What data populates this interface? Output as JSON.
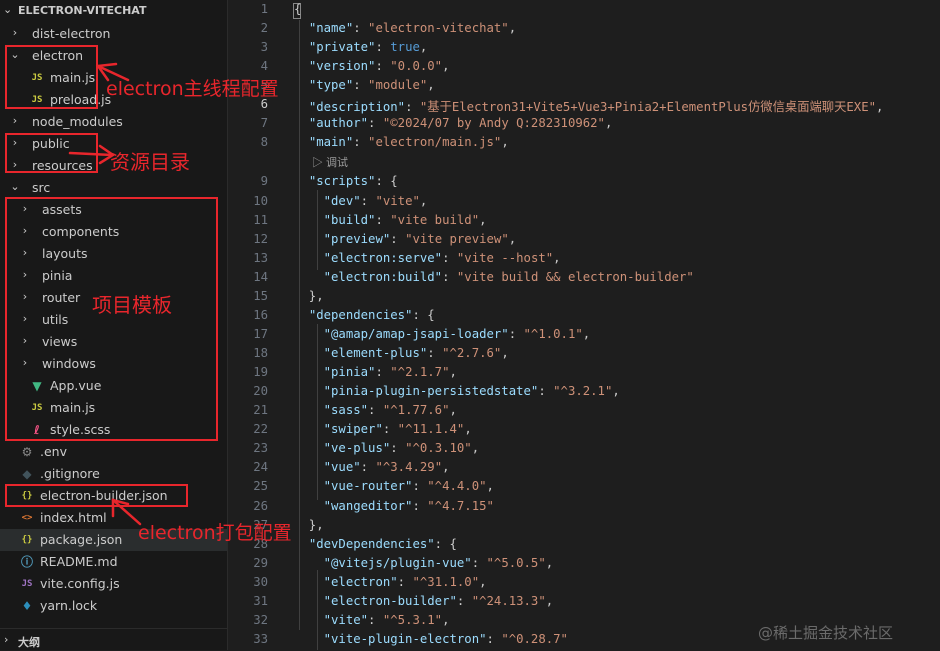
{
  "explorer": {
    "project": "ELECTRON-VITECHAT",
    "items": [
      {
        "name": "dist-electron",
        "type": "folder",
        "open": false,
        "depth": 0
      },
      {
        "name": "electron",
        "type": "folder",
        "open": true,
        "depth": 0
      },
      {
        "name": "main.js",
        "type": "js",
        "depth": 1
      },
      {
        "name": "preload.js",
        "type": "js",
        "depth": 1
      },
      {
        "name": "node_modules",
        "type": "folder",
        "open": false,
        "depth": 0
      },
      {
        "name": "public",
        "type": "folder",
        "open": false,
        "depth": 0
      },
      {
        "name": "resources",
        "type": "folder",
        "open": false,
        "depth": 0
      },
      {
        "name": "src",
        "type": "folder",
        "open": true,
        "depth": 0
      },
      {
        "name": "assets",
        "type": "folder",
        "open": false,
        "depth": 1
      },
      {
        "name": "components",
        "type": "folder",
        "open": false,
        "depth": 1
      },
      {
        "name": "layouts",
        "type": "folder",
        "open": false,
        "depth": 1
      },
      {
        "name": "pinia",
        "type": "folder",
        "open": false,
        "depth": 1
      },
      {
        "name": "router",
        "type": "folder",
        "open": false,
        "depth": 1
      },
      {
        "name": "utils",
        "type": "folder",
        "open": false,
        "depth": 1
      },
      {
        "name": "views",
        "type": "folder",
        "open": false,
        "depth": 1
      },
      {
        "name": "windows",
        "type": "folder",
        "open": false,
        "depth": 1
      },
      {
        "name": "App.vue",
        "type": "vue",
        "depth": 1
      },
      {
        "name": "main.js",
        "type": "js",
        "depth": 1
      },
      {
        "name": "style.scss",
        "type": "sass",
        "depth": 1
      },
      {
        "name": ".env",
        "type": "gear",
        "depth": 0
      },
      {
        "name": ".gitignore",
        "type": "git",
        "depth": 0
      },
      {
        "name": "electron-builder.json",
        "type": "json",
        "depth": 0
      },
      {
        "name": "index.html",
        "type": "html",
        "depth": 0
      },
      {
        "name": "package.json",
        "type": "json",
        "depth": 0,
        "selected": true
      },
      {
        "name": "README.md",
        "type": "info",
        "depth": 0
      },
      {
        "name": "vite.config.js",
        "type": "vite",
        "depth": 0
      },
      {
        "name": "yarn.lock",
        "type": "yarn",
        "depth": 0
      }
    ],
    "outline_label": "大纲"
  },
  "icons": {
    "folder_closed": "chevron-right-icon",
    "folder_open": "chevron-down-icon",
    "js": "JS",
    "json": "{}",
    "vue": "▼",
    "gear": "⚙",
    "git": "◆",
    "html": "<>",
    "info": "ⓘ",
    "vite": "JS",
    "yarn": "♦",
    "sass": "ℓ"
  },
  "editor": {
    "codelens": "▷ 调试",
    "lines": [
      [
        [
          "p",
          "{"
        ]
      ],
      [
        [
          "p",
          "  "
        ],
        [
          "k",
          "\"name\""
        ],
        [
          "p",
          ": "
        ],
        [
          "s",
          "\"electron-vitechat\""
        ],
        [
          "p",
          ","
        ]
      ],
      [
        [
          "p",
          "  "
        ],
        [
          "k",
          "\"private\""
        ],
        [
          "p",
          ": "
        ],
        [
          "b",
          "true"
        ],
        [
          "p",
          ","
        ]
      ],
      [
        [
          "p",
          "  "
        ],
        [
          "k",
          "\"version\""
        ],
        [
          "p",
          ": "
        ],
        [
          "s",
          "\"0.0.0\""
        ],
        [
          "p",
          ","
        ]
      ],
      [
        [
          "p",
          "  "
        ],
        [
          "k",
          "\"type\""
        ],
        [
          "p",
          ": "
        ],
        [
          "s",
          "\"module\""
        ],
        [
          "p",
          ","
        ]
      ],
      [
        [
          "p",
          "  "
        ],
        [
          "k",
          "\"description\""
        ],
        [
          "p",
          ": "
        ],
        [
          "s",
          "\"基于Electron31+Vite5+Vue3+Pinia2+ElementPlus仿微信桌面端聊天EXE\""
        ],
        [
          "p",
          ","
        ]
      ],
      [
        [
          "p",
          "  "
        ],
        [
          "k",
          "\"author\""
        ],
        [
          "p",
          ": "
        ],
        [
          "s",
          "\"©2024/07 by Andy Q:282310962\""
        ],
        [
          "p",
          ","
        ]
      ],
      [
        [
          "p",
          "  "
        ],
        [
          "k",
          "\"main\""
        ],
        [
          "p",
          ": "
        ],
        [
          "s",
          "\"electron/main.js\""
        ],
        [
          "p",
          ","
        ]
      ],
      [
        [
          "p",
          "  "
        ],
        [
          "k",
          "\"scripts\""
        ],
        [
          "p",
          ": {"
        ]
      ],
      [
        [
          "p",
          "    "
        ],
        [
          "k",
          "\"dev\""
        ],
        [
          "p",
          ": "
        ],
        [
          "s",
          "\"vite\""
        ],
        [
          "p",
          ","
        ]
      ],
      [
        [
          "p",
          "    "
        ],
        [
          "k",
          "\"build\""
        ],
        [
          "p",
          ": "
        ],
        [
          "s",
          "\"vite build\""
        ],
        [
          "p",
          ","
        ]
      ],
      [
        [
          "p",
          "    "
        ],
        [
          "k",
          "\"preview\""
        ],
        [
          "p",
          ": "
        ],
        [
          "s",
          "\"vite preview\""
        ],
        [
          "p",
          ","
        ]
      ],
      [
        [
          "p",
          "    "
        ],
        [
          "k",
          "\"electron:serve\""
        ],
        [
          "p",
          ": "
        ],
        [
          "s",
          "\"vite --host\""
        ],
        [
          "p",
          ","
        ]
      ],
      [
        [
          "p",
          "    "
        ],
        [
          "k",
          "\"electron:build\""
        ],
        [
          "p",
          ": "
        ],
        [
          "s",
          "\"vite build && electron-builder\""
        ]
      ],
      [
        [
          "p",
          "  },"
        ]
      ],
      [
        [
          "p",
          "  "
        ],
        [
          "k",
          "\"dependencies\""
        ],
        [
          "p",
          ": {"
        ]
      ],
      [
        [
          "p",
          "    "
        ],
        [
          "k",
          "\"@amap/amap-jsapi-loader\""
        ],
        [
          "p",
          ": "
        ],
        [
          "s",
          "\"^1.0.1\""
        ],
        [
          "p",
          ","
        ]
      ],
      [
        [
          "p",
          "    "
        ],
        [
          "k",
          "\"element-plus\""
        ],
        [
          "p",
          ": "
        ],
        [
          "s",
          "\"^2.7.6\""
        ],
        [
          "p",
          ","
        ]
      ],
      [
        [
          "p",
          "    "
        ],
        [
          "k",
          "\"pinia\""
        ],
        [
          "p",
          ": "
        ],
        [
          "s",
          "\"^2.1.7\""
        ],
        [
          "p",
          ","
        ]
      ],
      [
        [
          "p",
          "    "
        ],
        [
          "k",
          "\"pinia-plugin-persistedstate\""
        ],
        [
          "p",
          ": "
        ],
        [
          "s",
          "\"^3.2.1\""
        ],
        [
          "p",
          ","
        ]
      ],
      [
        [
          "p",
          "    "
        ],
        [
          "k",
          "\"sass\""
        ],
        [
          "p",
          ": "
        ],
        [
          "s",
          "\"^1.77.6\""
        ],
        [
          "p",
          ","
        ]
      ],
      [
        [
          "p",
          "    "
        ],
        [
          "k",
          "\"swiper\""
        ],
        [
          "p",
          ": "
        ],
        [
          "s",
          "\"^11.1.4\""
        ],
        [
          "p",
          ","
        ]
      ],
      [
        [
          "p",
          "    "
        ],
        [
          "k",
          "\"ve-plus\""
        ],
        [
          "p",
          ": "
        ],
        [
          "s",
          "\"^0.3.10\""
        ],
        [
          "p",
          ","
        ]
      ],
      [
        [
          "p",
          "    "
        ],
        [
          "k",
          "\"vue\""
        ],
        [
          "p",
          ": "
        ],
        [
          "s",
          "\"^3.4.29\""
        ],
        [
          "p",
          ","
        ]
      ],
      [
        [
          "p",
          "    "
        ],
        [
          "k",
          "\"vue-router\""
        ],
        [
          "p",
          ": "
        ],
        [
          "s",
          "\"^4.4.0\""
        ],
        [
          "p",
          ","
        ]
      ],
      [
        [
          "p",
          "    "
        ],
        [
          "k",
          "\"wangeditor\""
        ],
        [
          "p",
          ": "
        ],
        [
          "s",
          "\"^4.7.15\""
        ]
      ],
      [
        [
          "p",
          "  },"
        ]
      ],
      [
        [
          "p",
          "  "
        ],
        [
          "k",
          "\"devDependencies\""
        ],
        [
          "p",
          ": {"
        ]
      ],
      [
        [
          "p",
          "    "
        ],
        [
          "k",
          "\"@vitejs/plugin-vue\""
        ],
        [
          "p",
          ": "
        ],
        [
          "s",
          "\"^5.0.5\""
        ],
        [
          "p",
          ","
        ]
      ],
      [
        [
          "p",
          "    "
        ],
        [
          "k",
          "\"electron\""
        ],
        [
          "p",
          ": "
        ],
        [
          "s",
          "\"^31.1.0\""
        ],
        [
          "p",
          ","
        ]
      ],
      [
        [
          "p",
          "    "
        ],
        [
          "k",
          "\"electron-builder\""
        ],
        [
          "p",
          ": "
        ],
        [
          "s",
          "\"^24.13.3\""
        ],
        [
          "p",
          ","
        ]
      ],
      [
        [
          "p",
          "    "
        ],
        [
          "k",
          "\"vite\""
        ],
        [
          "p",
          ": "
        ],
        [
          "s",
          "\"^5.3.1\""
        ],
        [
          "p",
          ","
        ]
      ],
      [
        [
          "p",
          "    "
        ],
        [
          "k",
          "\"vite-plugin-electron\""
        ],
        [
          "p",
          ": "
        ],
        [
          "s",
          "\"^0.28.7\""
        ]
      ]
    ],
    "current_line": 6
  },
  "annotations": [
    {
      "text": "electron主线程配置"
    },
    {
      "text": "资源目录"
    },
    {
      "text": "项目模板"
    },
    {
      "text": "electron打包配置"
    }
  ],
  "watermark": "@稀土掘金技术社区",
  "colors": {
    "annotation": "#e8262c",
    "key": "#9cdcfe",
    "string": "#ce9178",
    "keyword": "#569cd6"
  }
}
